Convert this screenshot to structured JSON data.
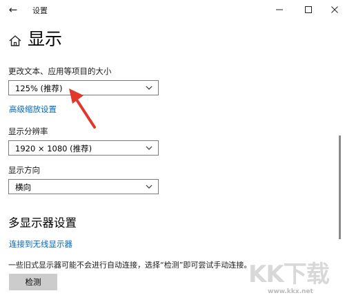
{
  "window": {
    "title": "设置",
    "back_glyph": "←",
    "controls": [
      "minimize-icon",
      "maximize-icon",
      "close-icon"
    ]
  },
  "page": {
    "title": "显示",
    "icon": "home-icon"
  },
  "scale": {
    "label": "更改文本、应用等项目的大小",
    "value": "125% (推荐)",
    "advanced_link": "高级缩放设置"
  },
  "resolution": {
    "label": "显示分辨率",
    "value": "1920 × 1080 (推荐)"
  },
  "orientation": {
    "label": "显示方向",
    "value": "横向"
  },
  "multi_display": {
    "title": "多显示器设置",
    "wireless_link": "连接到无线显示器",
    "note": "一些旧式显示器可能不会进行自动连接，选择“检测”即可尝试手动连接。",
    "detect_button": "检测"
  },
  "watermark": {
    "text": "KK下载",
    "url": "www.kkx.net"
  },
  "colors": {
    "link": "#0067c0",
    "arrow": "#e0392b",
    "button_bg": "#cccccc"
  }
}
